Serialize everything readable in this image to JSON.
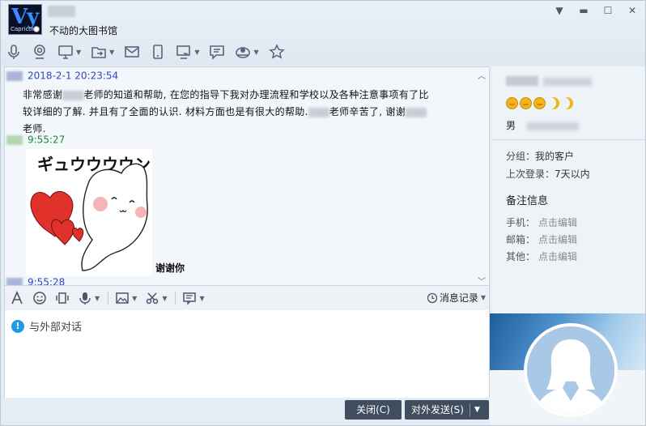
{
  "header": {
    "avatar_text": "Vy",
    "avatar_subtext": "Capricorn",
    "signature": "不动的大图书馆"
  },
  "toolbar": {
    "icons": [
      "microphone-icon",
      "camera-icon",
      "monitor-icon",
      "share-file-icon",
      "mail-icon",
      "phone-icon",
      "screenshot-icon",
      "message-icon",
      "app-icon",
      "favorite-icon"
    ]
  },
  "chat": {
    "messages": [
      {
        "timestamp": "2018-2-1 20:23:54",
        "line1_part1": "非常感谢",
        "line1_part2": "老师的知道和帮助, 在您的指导下我对办理流程和学校以及各种注意事项有了比",
        "line2": "较详细的了解. 并且有了全面的认识. 材料方面也是有很大的帮助.",
        "line2_part2": "老师辛苦了, 谢谢",
        "line3": "老师."
      },
      {
        "timestamp": "9:55:27",
        "sticker_caption": "谢谢你",
        "sticker_text": "ギュウウウウン"
      },
      {
        "timestamp": "9:55:28"
      }
    ]
  },
  "input": {
    "history_label": "消息记录",
    "notice": "与外部对话"
  },
  "footer": {
    "close_label": "关闭(C)",
    "send_label": "对外发送(S)"
  },
  "side": {
    "gender": "男",
    "group_label": "分组：",
    "group_value": "我的客户",
    "last_login_label": "上次登录：",
    "last_login_value": "7天以内",
    "notes_title": "备注信息",
    "phone_label": "手机：",
    "email_label": "邮箱：",
    "other_label": "其他：",
    "edit_label": "点击编辑"
  },
  "colors": {
    "accent": "#2b49c6",
    "green_timestamp": "#1a8a3a",
    "button_dark": "#3f4d5e"
  }
}
